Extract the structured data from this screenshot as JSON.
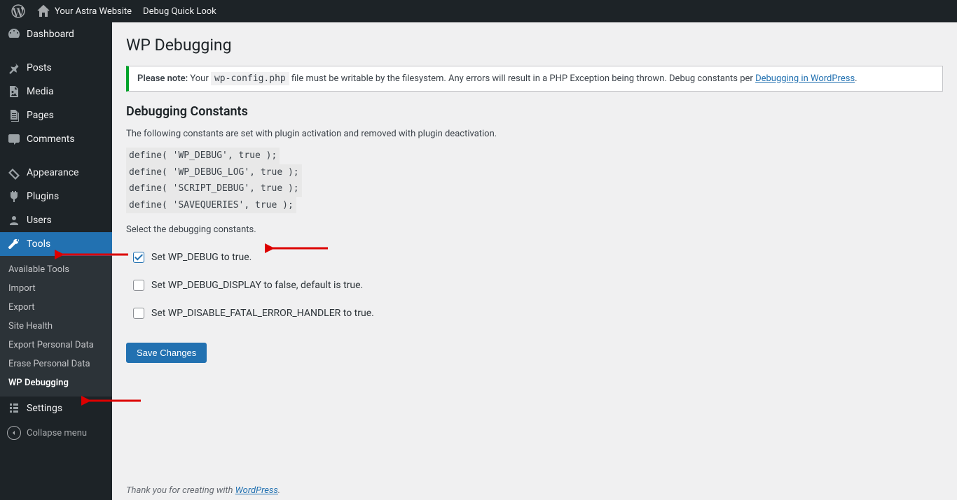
{
  "adminbar": {
    "site_name": "Your Astra Website",
    "quick_link": "Debug Quick Look"
  },
  "sidebar": {
    "items": [
      {
        "label": "Dashboard"
      },
      {
        "label": "Posts"
      },
      {
        "label": "Media"
      },
      {
        "label": "Pages"
      },
      {
        "label": "Comments"
      },
      {
        "label": "Appearance"
      },
      {
        "label": "Plugins"
      },
      {
        "label": "Users"
      },
      {
        "label": "Tools"
      },
      {
        "label": "Settings"
      }
    ],
    "tools_submenu": [
      {
        "label": "Available Tools"
      },
      {
        "label": "Import"
      },
      {
        "label": "Export"
      },
      {
        "label": "Site Health"
      },
      {
        "label": "Export Personal Data"
      },
      {
        "label": "Erase Personal Data"
      },
      {
        "label": "WP Debugging"
      }
    ],
    "collapse_label": "Collapse menu"
  },
  "page": {
    "title": "WP Debugging",
    "notice_strong": "Please note:",
    "notice_before": " Your ",
    "notice_code": "wp-config.php",
    "notice_after": " file must be writable by the filesystem. Any errors will result in a PHP Exception being thrown. Debug constants per ",
    "notice_link": "Debugging in WordPress",
    "notice_tail": ".",
    "section_title": "Debugging Constants",
    "intro": "The following constants are set with plugin activation and removed with plugin deactivation.",
    "code_lines": [
      "define( 'WP_DEBUG', true );",
      "define( 'WP_DEBUG_LOG', true );",
      "define( 'SCRIPT_DEBUG', true );",
      "define( 'SAVEQUERIES', true );"
    ],
    "select_prompt": "Select the debugging constants.",
    "checks": [
      {
        "label": "Set WP_DEBUG to true.",
        "checked": true
      },
      {
        "label": "Set WP_DEBUG_DISPLAY to false, default is true.",
        "checked": false
      },
      {
        "label": "Set WP_DISABLE_FATAL_ERROR_HANDLER to true.",
        "checked": false
      }
    ],
    "save_label": "Save Changes",
    "footer_before": "Thank you for creating with ",
    "footer_link": "WordPress",
    "footer_after": "."
  }
}
